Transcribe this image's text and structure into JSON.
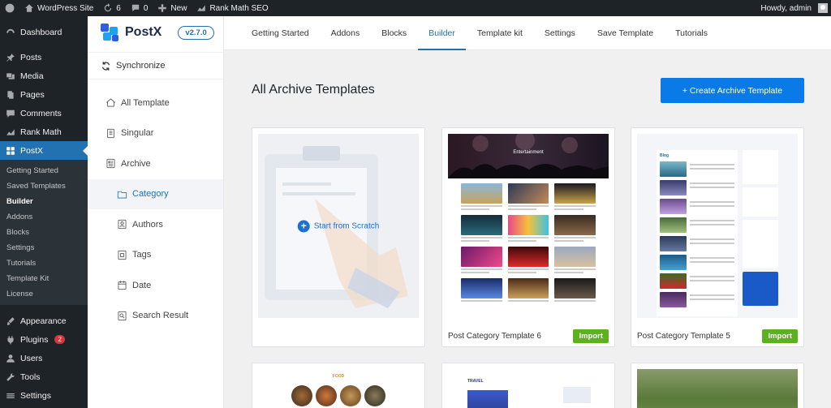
{
  "admin_bar": {
    "site_name": "WordPress Site",
    "updates_count": "6",
    "comments_count": "0",
    "new_label": "New",
    "seo_label": "Rank Math SEO",
    "greeting": "Howdy, admin"
  },
  "wp_menu": {
    "items_top": [
      {
        "label": "Dashboard",
        "icon": "dashboard-icon"
      },
      {
        "label": "Posts",
        "icon": "pin-icon"
      },
      {
        "label": "Media",
        "icon": "media-icon"
      },
      {
        "label": "Pages",
        "icon": "pages-icon"
      },
      {
        "label": "Comments",
        "icon": "comment-icon"
      },
      {
        "label": "Rank Math",
        "icon": "chart-icon"
      }
    ],
    "active": {
      "label": "PostX",
      "icon": "postx-icon"
    },
    "submenu": [
      {
        "label": "Getting Started"
      },
      {
        "label": "Saved Templates"
      },
      {
        "label": "Builder"
      },
      {
        "label": "Addons"
      },
      {
        "label": "Blocks"
      },
      {
        "label": "Settings"
      },
      {
        "label": "Tutorials"
      },
      {
        "label": "Template Kit"
      },
      {
        "label": "License"
      }
    ],
    "items_bottom": [
      {
        "label": "Appearance",
        "icon": "brush-icon"
      },
      {
        "label": "Plugins",
        "icon": "plugin-icon",
        "badge": "2"
      },
      {
        "label": "Users",
        "icon": "users-icon"
      },
      {
        "label": "Tools",
        "icon": "wrench-icon"
      },
      {
        "label": "Settings",
        "icon": "settings-icon"
      }
    ]
  },
  "postx": {
    "name": "PostX",
    "version": "v2.7.0",
    "synchronize": "Synchronize",
    "nav": [
      {
        "label": "All Template",
        "icon": "home-icon"
      },
      {
        "label": "Singular",
        "icon": "document-icon"
      },
      {
        "label": "Archive",
        "icon": "archive-icon"
      },
      {
        "label": "Category",
        "icon": "folder-icon"
      },
      {
        "label": "Authors",
        "icon": "author-icon"
      },
      {
        "label": "Tags",
        "icon": "tag-icon"
      },
      {
        "label": "Date",
        "icon": "calendar-icon"
      },
      {
        "label": "Search Result",
        "icon": "search-icon"
      }
    ]
  },
  "tabs": [
    "Getting Started",
    "Addons",
    "Blocks",
    "Builder",
    "Template kit",
    "Settings",
    "Save Template",
    "Tutorials"
  ],
  "main": {
    "title": "All Archive Templates",
    "create_button": "+ Create Archive Template",
    "scratch_label": "Start from Scratch",
    "cards": [
      {
        "name": "Post Category Template 6",
        "import": "Import",
        "thumb_heading": "Entertainment"
      },
      {
        "name": "Post Category Template 5",
        "import": "Import",
        "thumb_heading": "Blog"
      }
    ],
    "lower_thumb_headings": [
      "FOOD",
      "TRAVEL"
    ]
  },
  "colors": {
    "accent": "#2271b1",
    "create": "#0a7ae6",
    "import": "#5cb21d",
    "admin_dark": "#1d2327"
  }
}
